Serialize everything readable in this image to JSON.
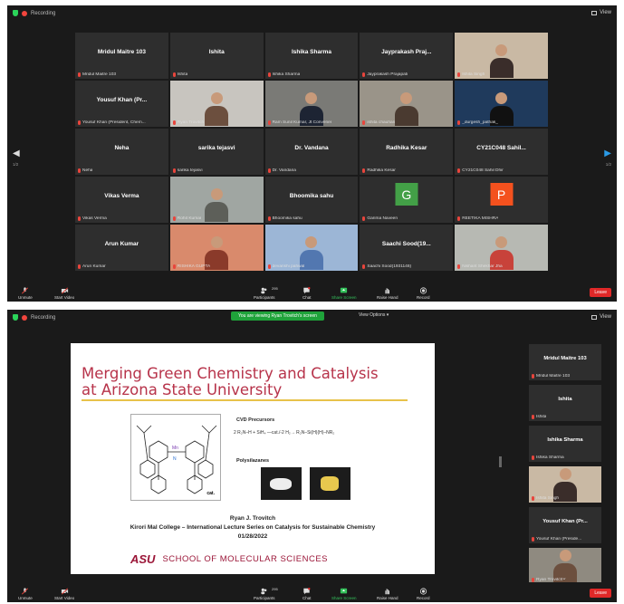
{
  "shot1": {
    "recording": "Recording",
    "view": "View",
    "page_left": "1/2",
    "page_right": "1/2",
    "tiles": [
      {
        "name": "Mridul Maitre 103",
        "label": "Mridul Maitre 103",
        "kind": "name"
      },
      {
        "name": "Ishita",
        "label": "Ishita",
        "kind": "name"
      },
      {
        "name": "Ishika Sharma",
        "label": "Ishika Sharma",
        "kind": "name"
      },
      {
        "name": "Jayprakash  Praj...",
        "label": "Jayprakash Prajapati",
        "kind": "name"
      },
      {
        "name": "",
        "label": "Ishita Singh",
        "kind": "video",
        "bg": "#c9b9a4",
        "body": "#3a2d2a"
      },
      {
        "name": "Yousuf Khan (Pr...",
        "label": "Yousuf Khan (President, Chem...",
        "kind": "name"
      },
      {
        "name": "",
        "label": "Ryan Trovitch",
        "kind": "video",
        "bg": "#c8c5bf",
        "body": "#6c4f3e"
      },
      {
        "name": "",
        "label": "Ram Sunil Kumar, Jt Convener",
        "kind": "video",
        "bg": "#7a7a76",
        "body": "#1d2433"
      },
      {
        "name": "",
        "label": "ishita chauhan",
        "kind": "video",
        "bg": "#9a9489",
        "body": "#4a3a30",
        "active": true
      },
      {
        "name": "",
        "label": "_durgesh_pathak_",
        "kind": "video",
        "bg": "#1f3a5c",
        "body": "#111"
      },
      {
        "name": "Neha",
        "label": "Neha",
        "kind": "name"
      },
      {
        "name": "sarika tejasvi",
        "label": "sarika tejasvi",
        "kind": "name"
      },
      {
        "name": "Dr. Vandana",
        "label": "Dr. Vandana",
        "kind": "name"
      },
      {
        "name": "Radhika Kesar",
        "label": "Radhika Kesar",
        "kind": "name"
      },
      {
        "name": "CY21C048  Sahil...",
        "label": "CY21C048 Sahil Dhir",
        "kind": "name"
      },
      {
        "name": "Vikas Verma",
        "label": "Vikas Verma",
        "kind": "name"
      },
      {
        "name": "",
        "label": "Rohit Kumar",
        "kind": "video",
        "bg": "#a0a6a2",
        "body": "#5d5f59"
      },
      {
        "name": "Bhoomika sahu",
        "label": "Bhoomika sahu",
        "kind": "name"
      },
      {
        "name": "",
        "label": "Garima Naveen",
        "kind": "avatar",
        "letter": "G",
        "color": "#43a047"
      },
      {
        "name": "",
        "label": "REETIKA MISHRA",
        "kind": "avatar",
        "letter": "P",
        "color": "#f4511e"
      },
      {
        "name": "Arun Kumar",
        "label": "Arun Kumar",
        "kind": "name"
      },
      {
        "name": "",
        "label": "RISHIKA GUPTA",
        "kind": "video",
        "bg": "#d98a6c",
        "body": "#8a3a2a"
      },
      {
        "name": "",
        "label": "devanshi pahwal",
        "kind": "video",
        "bg": "#9cb6d6",
        "body": "#5277b0"
      },
      {
        "name": "Saachi  Sood(19...",
        "label": "Saachi Sood(1931148)",
        "kind": "name"
      },
      {
        "name": "",
        "label": "Nishant Shekhar Jha",
        "kind": "video",
        "bg": "#b7b9b3",
        "body": "#c8423a"
      }
    ],
    "toolbar": {
      "unmute": "Unmute",
      "start_video": "Start Video",
      "participants": "Participants",
      "participants_count": "295",
      "chat": "Chat",
      "share_screen": "Share Screen",
      "raise_hand": "Raise Hand",
      "record": "Record",
      "leave": "Leave"
    }
  },
  "shot2": {
    "recording": "Recording",
    "view": "View",
    "banner": "You are viewing Ryan Trovitch's screen",
    "view_options": "View Options",
    "slide": {
      "title_line1": "Merging Green Chemistry and Catalysis",
      "title_line2": "at Arizona State University",
      "cvd": "CVD Precursors",
      "equation": "2 R₂N–H + SiH₄  —cat./-2 H₂→  R₂N–Si(H)(H)–NR₂",
      "poly": "Polysilazanes",
      "mol_label": "cat.",
      "speaker": "Ryan J. Trovitch",
      "event": "Kirori Mal College – International Lecture Series on Catalysis for Sustainable Chemistry",
      "date": "01/28/2022",
      "asu": "ASU",
      "school": "SCHOOL OF MOLECULAR SCIENCES"
    },
    "side_tiles": [
      {
        "name": "Mridul Maitre 103",
        "label": "Mridul Maitre 103",
        "kind": "name"
      },
      {
        "name": "Ishita",
        "label": "Ishita",
        "kind": "name"
      },
      {
        "name": "Ishika Sharma",
        "label": "Ishika Sharma",
        "kind": "name"
      },
      {
        "name": "",
        "label": "Ishita Singh",
        "kind": "video",
        "active": true
      },
      {
        "name": "Yousuf Khan (Pr...",
        "label": "Yousuf Khan (Preside...",
        "kind": "name"
      },
      {
        "name": "",
        "label": "Ryan Trovitch",
        "kind": "video"
      }
    ],
    "toolbar": {
      "unmute": "Unmute",
      "start_video": "Start Video",
      "participants": "Participants",
      "participants_count": "295",
      "chat": "Chat",
      "share_screen": "Share Screen",
      "raise_hand": "Raise Hand",
      "record": "Record",
      "leave": "Leave"
    }
  },
  "colors": {
    "zoom_bg": "#1a1a1a",
    "tile_bg": "#2e2e2e",
    "active_speaker": "#f2e000",
    "leave_red": "#e02828",
    "share_green": "#1fa33a",
    "asu_maroon": "#9b1638"
  }
}
